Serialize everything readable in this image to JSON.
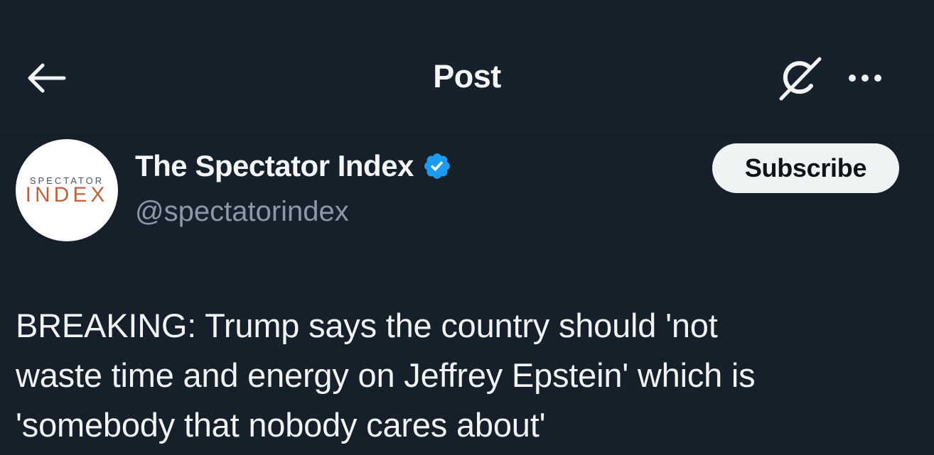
{
  "header": {
    "title": "Post",
    "back_icon": "arrow-left-icon",
    "grok_icon": "grok-icon",
    "more_icon": "more-horizontal-icon"
  },
  "author": {
    "avatar": {
      "logo_top": "SPECTATOR",
      "logo_bottom": "INDEX"
    },
    "display_name": "The Spectator Index",
    "handle": "@spectatorindex",
    "verified_icon": "verified-badge-icon",
    "verified_color": "#1d9bf0"
  },
  "subscribe": {
    "label": "Subscribe"
  },
  "post": {
    "lines": [
      "BREAKING: Trump says the country should 'not",
      "waste time and energy on Jeffrey Epstein' which is",
      "'somebody that nobody cares about'"
    ]
  },
  "colors": {
    "background": "#15202b",
    "text": "#e7e9ea",
    "secondary_text": "#8b98a5",
    "button_bg": "#eff3f4"
  }
}
